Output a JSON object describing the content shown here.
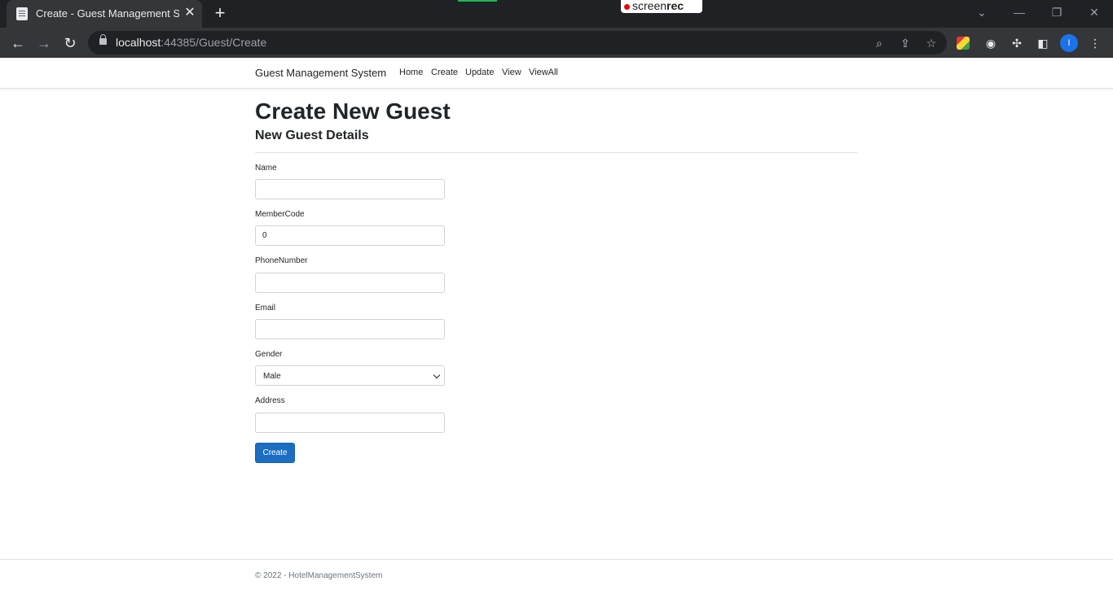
{
  "browser": {
    "tab_title": "Create - Guest Management Syst",
    "tab_close": "✕",
    "new_tab": "+",
    "url_host": "localhost",
    "url_path": ":44385/Guest/Create",
    "recorder_prefix": "screen",
    "recorder_suffix": "rec",
    "profile_initial": "I"
  },
  "navbar": {
    "brand": "Guest Management System",
    "links": [
      "Home",
      "Create",
      "Update",
      "View",
      "ViewAll"
    ]
  },
  "main": {
    "title": "Create New Guest",
    "subtitle": "New Guest Details",
    "fields": {
      "name": {
        "label": "Name",
        "value": ""
      },
      "member_code": {
        "label": "MemberCode",
        "value": "0"
      },
      "phone": {
        "label": "PhoneNumber",
        "value": ""
      },
      "email": {
        "label": "Email",
        "value": ""
      },
      "gender": {
        "label": "Gender",
        "selected": "Male"
      },
      "address": {
        "label": "Address",
        "value": ""
      }
    },
    "submit_label": "Create"
  },
  "footer": {
    "text": "© 2022 - HotelManagementSystem"
  },
  "colors": {
    "primary_button": "#1b6ec2",
    "chrome_dark": "#202124",
    "chrome_toolbar": "#35363a"
  }
}
